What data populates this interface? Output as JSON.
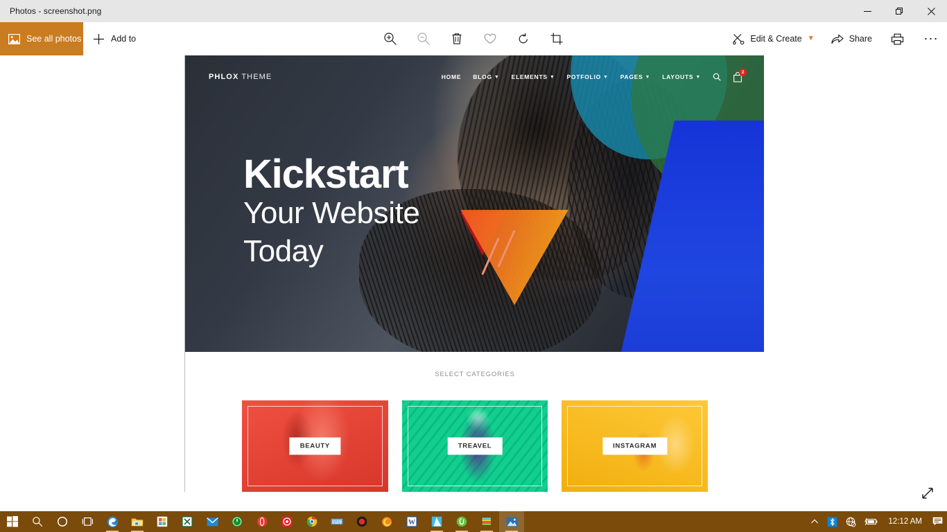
{
  "window": {
    "title": "Photos - screenshot.png",
    "controls": {
      "minimize": "minimize-button",
      "restore": "restore-button",
      "close": "close-button"
    }
  },
  "commandbar": {
    "see_all_photos": "See all photos",
    "add_to": "Add to",
    "tools": [
      {
        "name": "zoom-in-icon",
        "label": "Zoom in",
        "disabled": false
      },
      {
        "name": "zoom-out-icon",
        "label": "Zoom out",
        "disabled": true
      },
      {
        "name": "delete-icon",
        "label": "Delete",
        "disabled": false
      },
      {
        "name": "favorite-icon",
        "label": "Add to favorites",
        "disabled": false
      },
      {
        "name": "rotate-icon",
        "label": "Rotate",
        "disabled": false
      },
      {
        "name": "crop-icon",
        "label": "Crop & rotate",
        "disabled": false
      }
    ],
    "edit_create": "Edit & Create",
    "share": "Share",
    "print": "Print",
    "more": "..."
  },
  "photo": {
    "hero": {
      "logo_bold": "PHLOX",
      "logo_light": " THEME",
      "nav": [
        {
          "label": "HOME",
          "caret": false
        },
        {
          "label": "BLOG",
          "caret": true
        },
        {
          "label": "ELEMENTS",
          "caret": true
        },
        {
          "label": "POTFOLIO",
          "caret": true
        },
        {
          "label": "PAGES",
          "caret": true
        },
        {
          "label": "LAYOUTS",
          "caret": true
        }
      ],
      "search_icon": "search-icon",
      "cart_icon": "cart-icon",
      "cart_count": "2",
      "headline_bold": "Kickstart",
      "headline_line2": "Your Website",
      "headline_line3": "Today"
    },
    "categories": {
      "section_label": "SELECT CATEGORIES",
      "cards": [
        {
          "label": "BEAUTY",
          "color": "#ea4335"
        },
        {
          "label": "TREAVEL",
          "color": "#11cf8e"
        },
        {
          "label": "INSTAGRAM",
          "color": "#fdbe14"
        }
      ]
    },
    "expand_label": "Expand"
  },
  "taskbar": {
    "background": "#7a4b0a",
    "items": [
      {
        "name": "start-button",
        "glyph": "windows"
      },
      {
        "name": "search-taskbar-icon",
        "glyph": "search"
      },
      {
        "name": "cortana-icon",
        "glyph": "circle"
      },
      {
        "name": "task-view-icon",
        "glyph": "taskview"
      },
      {
        "name": "edge-icon",
        "glyph": "edge"
      },
      {
        "name": "file-explorer-icon",
        "glyph": "folder"
      },
      {
        "name": "microsoft-store-icon",
        "glyph": "store"
      },
      {
        "name": "excel-icon",
        "glyph": "excel"
      },
      {
        "name": "mail-icon",
        "glyph": "mail"
      },
      {
        "name": "utorrent-green-icon",
        "glyph": "ugreen"
      },
      {
        "name": "opera-icon",
        "glyph": "opera"
      },
      {
        "name": "camtasia-icon",
        "glyph": "target"
      },
      {
        "name": "chrome-icon",
        "glyph": "chrome"
      },
      {
        "name": "keyboard-icon",
        "glyph": "keyboard"
      },
      {
        "name": "record-icon",
        "glyph": "record"
      },
      {
        "name": "firefox-icon",
        "glyph": "firefox"
      },
      {
        "name": "word-icon",
        "glyph": "word"
      },
      {
        "name": "blue-app-icon",
        "glyph": "bluepeak"
      },
      {
        "name": "utorrent-icon",
        "glyph": "utorrent"
      },
      {
        "name": "winrar-icon",
        "glyph": "winrar"
      },
      {
        "name": "photos-icon",
        "glyph": "photos"
      }
    ],
    "tray": {
      "show_hidden": "show-hidden-icons",
      "bluetooth": "bluetooth-icon",
      "network": "network-no-internet-icon",
      "battery": "battery-icon",
      "clock": "12:12 AM",
      "action_center": "action-center-icon"
    }
  }
}
